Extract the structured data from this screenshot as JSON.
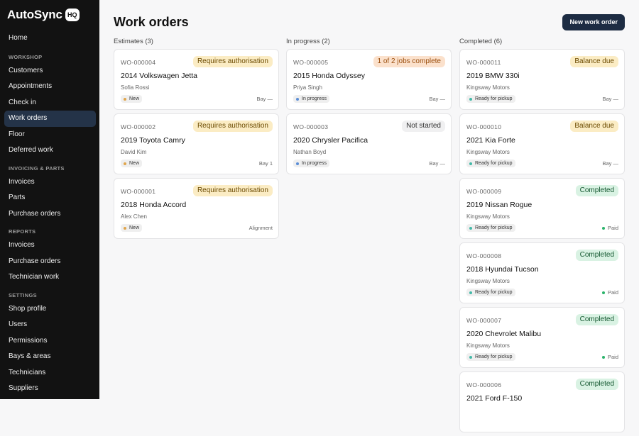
{
  "app": {
    "logo_text": "AutoSync",
    "logo_badge": "HQ"
  },
  "sidebar": {
    "home": "Home",
    "workshop_heading": "WORKSHOP",
    "workshop": [
      "Customers",
      "Appointments",
      "Check in",
      "Work orders",
      "Floor",
      "Deferred work"
    ],
    "invoicing_heading": "INVOICING & PARTS",
    "invoicing": [
      "Invoices",
      "Parts",
      "Purchase orders"
    ],
    "reports_heading": "REPORTS",
    "reports": [
      "Invoices",
      "Purchase orders",
      "Technician work"
    ],
    "settings_heading": "SETTINGS",
    "settings": [
      "Shop profile",
      "Users",
      "Permissions",
      "Bays & areas",
      "Technicians",
      "Suppliers"
    ]
  },
  "page": {
    "title": "Work orders",
    "new_button": "New work order"
  },
  "columns": [
    {
      "title": "Estimates (3)",
      "cards": [
        {
          "id": "WO-000004",
          "tag": "Requires authorisation",
          "vehicle": "2014 Volkswagen Jetta",
          "customer": "Sofia Rossi",
          "status": "New",
          "right": "Bay —"
        },
        {
          "id": "WO-000002",
          "tag": "Requires authorisation",
          "vehicle": "2019 Toyota Camry",
          "customer": "David Kim",
          "status": "New",
          "right": "Bay 1"
        },
        {
          "id": "WO-000001",
          "tag": "Requires authorisation",
          "vehicle": "2018 Honda Accord",
          "customer": "Alex Chen",
          "status": "New",
          "right": "Alignment"
        }
      ]
    },
    {
      "title": "In progress (2)",
      "cards": [
        {
          "id": "WO-000005",
          "tag": "1 of 2 jobs complete",
          "vehicle": "2015 Honda Odyssey",
          "customer": "Priya Singh",
          "status": "In progress",
          "right": "Bay —"
        },
        {
          "id": "WO-000003",
          "tag": "Not started",
          "vehicle": "2020 Chrysler Pacifica",
          "customer": "Nathan Boyd",
          "status": "In progress",
          "right": "Bay —"
        }
      ]
    },
    {
      "title": "Completed (6)",
      "cards": [
        {
          "id": "WO-000011",
          "tag": "Balance due",
          "vehicle": "2019 BMW 330i",
          "customer": "Kingsway Motors",
          "status": "Ready for pickup",
          "right": "Bay —"
        },
        {
          "id": "WO-000010",
          "tag": "Balance due",
          "vehicle": "2021 Kia Forte",
          "customer": "Kingsway Motors",
          "status": "Ready for pickup",
          "right": "Bay —"
        },
        {
          "id": "WO-000009",
          "tag": "Completed",
          "vehicle": "2019 Nissan Rogue",
          "customer": "Kingsway Motors",
          "status": "Ready for pickup",
          "right": "Paid"
        },
        {
          "id": "WO-000008",
          "tag": "Completed",
          "vehicle": "2018 Hyundai Tucson",
          "customer": "Kingsway Motors",
          "status": "Ready for pickup",
          "right": "Paid"
        },
        {
          "id": "WO-000007",
          "tag": "Completed",
          "vehicle": "2020 Chevrolet Malibu",
          "customer": "Kingsway Motors",
          "status": "Ready for pickup",
          "right": "Paid"
        },
        {
          "id": "WO-000006",
          "tag": "Completed",
          "vehicle": "2021 Ford F-150",
          "customer": "",
          "status": "",
          "right": ""
        }
      ]
    }
  ]
}
